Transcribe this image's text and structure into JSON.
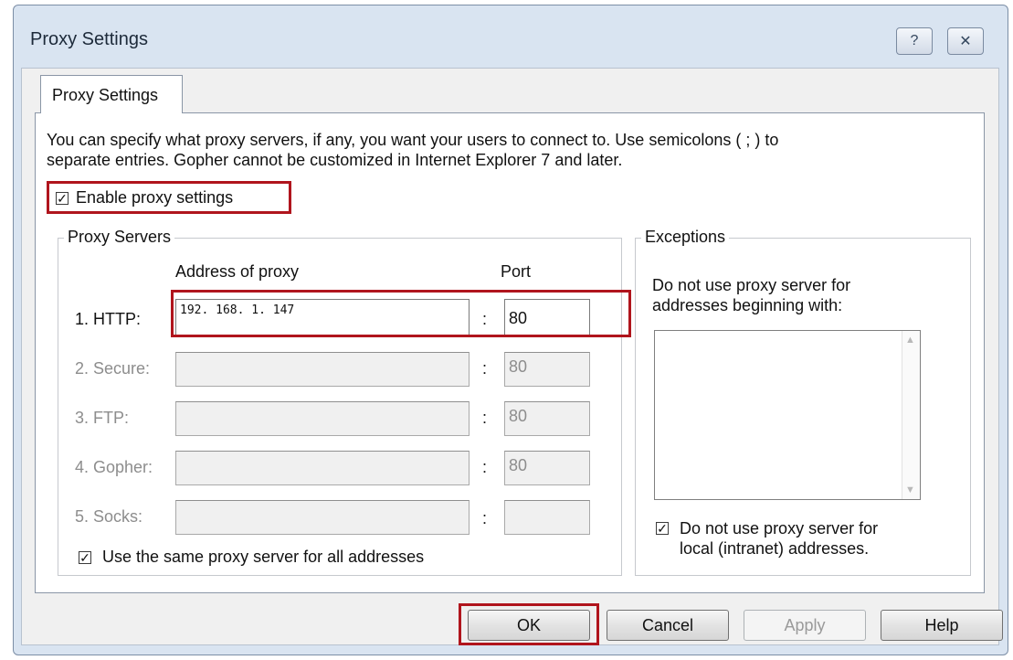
{
  "window": {
    "title": "Proxy Settings",
    "help_glyph": "?",
    "close_glyph": "✕"
  },
  "tab": {
    "label": "Proxy Settings"
  },
  "description": {
    "line1": "You can specify what proxy servers, if any, you want your users to connect to. Use semicolons ( ; ) to",
    "line2": "separate entries. Gopher cannot be customized in Internet Explorer 7 and later."
  },
  "enable_proxy": {
    "label": "Enable proxy settings",
    "checked": true
  },
  "proxy_servers": {
    "title": "Proxy Servers",
    "address_header": "Address of proxy",
    "port_header": "Port",
    "colon": ":",
    "rows": [
      {
        "label": "1. HTTP:",
        "address": "192. 168. 1. 147",
        "port": "80",
        "enabled": true
      },
      {
        "label": "2. Secure:",
        "address": "",
        "port": "80",
        "enabled": false
      },
      {
        "label": "3. FTP:",
        "address": "",
        "port": "80",
        "enabled": false
      },
      {
        "label": "4. Gopher:",
        "address": "",
        "port": "80",
        "enabled": false
      },
      {
        "label": "5. Socks:",
        "address": "",
        "port": "",
        "enabled": false
      }
    ],
    "same_proxy": {
      "label": "Use the same proxy server for all addresses",
      "checked": true
    }
  },
  "exceptions": {
    "title": "Exceptions",
    "desc_line1": "Do not use proxy server for",
    "desc_line2": "addresses beginning with:",
    "list_value": "",
    "local_bypass": {
      "line1": "Do not use proxy server for",
      "line2": "local (intranet) addresses.",
      "checked": true
    }
  },
  "buttons": {
    "ok": "OK",
    "cancel": "Cancel",
    "apply": "Apply",
    "help": "Help"
  },
  "colors": {
    "highlight_border": "#b0151d",
    "window_frame": "#d9e4f1",
    "disabled_text": "#8d8d8d"
  }
}
